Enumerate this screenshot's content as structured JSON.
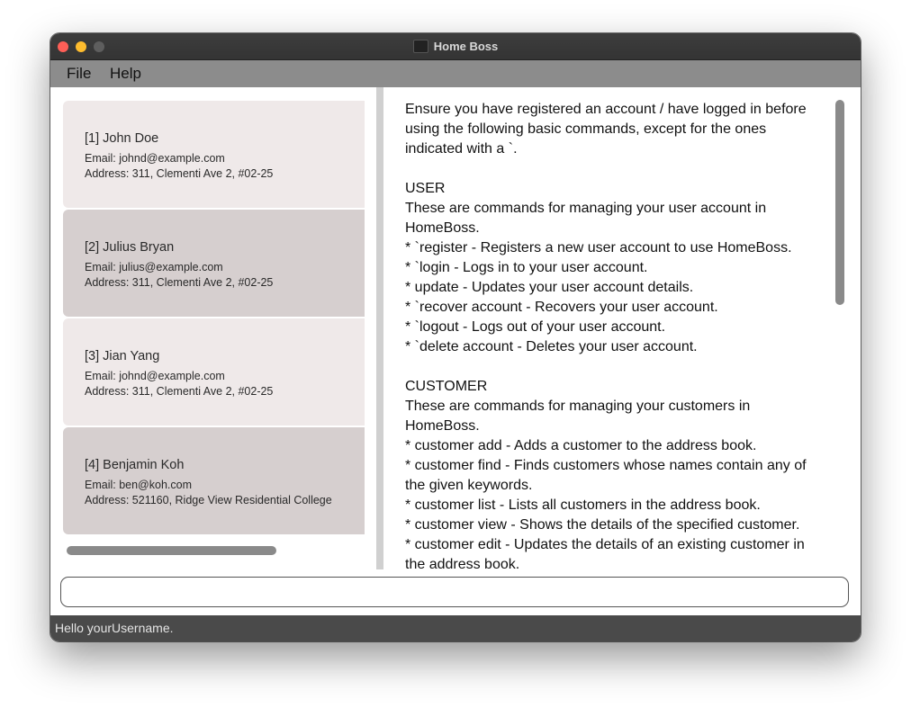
{
  "window": {
    "title": "Home Boss"
  },
  "menubar": {
    "file": "File",
    "help": "Help"
  },
  "customers": [
    {
      "name": "[1] John Doe",
      "email": "Email: johnd@example.com",
      "address": "Address: 311, Clementi Ave 2, #02-25"
    },
    {
      "name": "[2] Julius Bryan",
      "email": "Email: julius@example.com",
      "address": "Address: 311, Clementi Ave 2, #02-25"
    },
    {
      "name": "[3] Jian Yang",
      "email": "Email: johnd@example.com",
      "address": "Address: 311, Clementi Ave 2, #02-25"
    },
    {
      "name": "[4] Benjamin Koh",
      "email": "Email: ben@koh.com",
      "address": "Address: 521160, Ridge View Residential College"
    }
  ],
  "help_text": "Ensure you have registered an account / have logged in before using the following basic commands, except for the ones indicated with a `.\n\nUSER\nThese are commands for managing your user account in HomeBoss.\n* `register - Registers a new user account to use HomeBoss.\n* `login - Logs in to your user account.\n* update - Updates your user account details.\n* `recover account - Recovers your user account.\n* `logout - Logs out of your user account.\n* `delete account - Deletes your user account.\n\nCUSTOMER\nThese are commands for managing your customers in HomeBoss.\n* customer add - Adds a customer to the address book.\n* customer find - Finds customers whose names contain any of the given keywords.\n* customer list - Lists all customers in the address book.\n* customer view - Shows the details of the specified customer.\n* customer edit - Updates the details of an existing customer in the address book.",
  "command_box": {
    "value": "",
    "placeholder": ""
  },
  "status": {
    "text": "Hello yourUsername."
  },
  "colors": {
    "card_odd": "#efe9e9",
    "card_even": "#d6cfcf",
    "menubar": "#8c8c8c",
    "statusbar": "#4a4a4a"
  }
}
